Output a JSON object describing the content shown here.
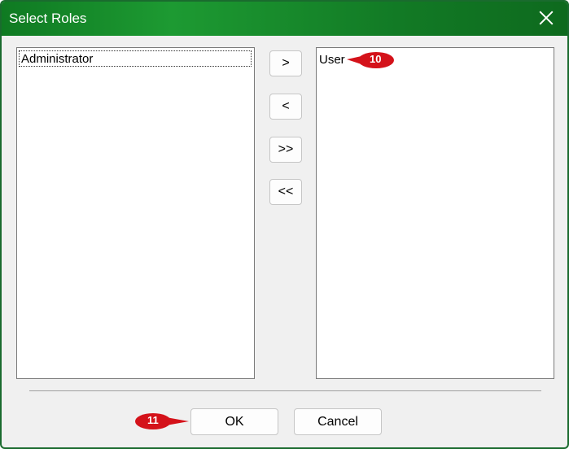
{
  "window": {
    "title": "Select Roles"
  },
  "available_roles": {
    "items": [
      "Administrator"
    ]
  },
  "selected_roles": {
    "items": [
      "User"
    ]
  },
  "move_buttons": {
    "add": ">",
    "remove": "<",
    "add_all": ">>",
    "remove_all": "<<"
  },
  "footer": {
    "ok_label": "OK",
    "cancel_label": "Cancel"
  },
  "callouts": [
    {
      "label": "10"
    },
    {
      "label": "11"
    }
  ],
  "colors": {
    "titlebar": "#127a25",
    "callout": "#d4121a"
  },
  "icons": {
    "close": "close-icon"
  }
}
